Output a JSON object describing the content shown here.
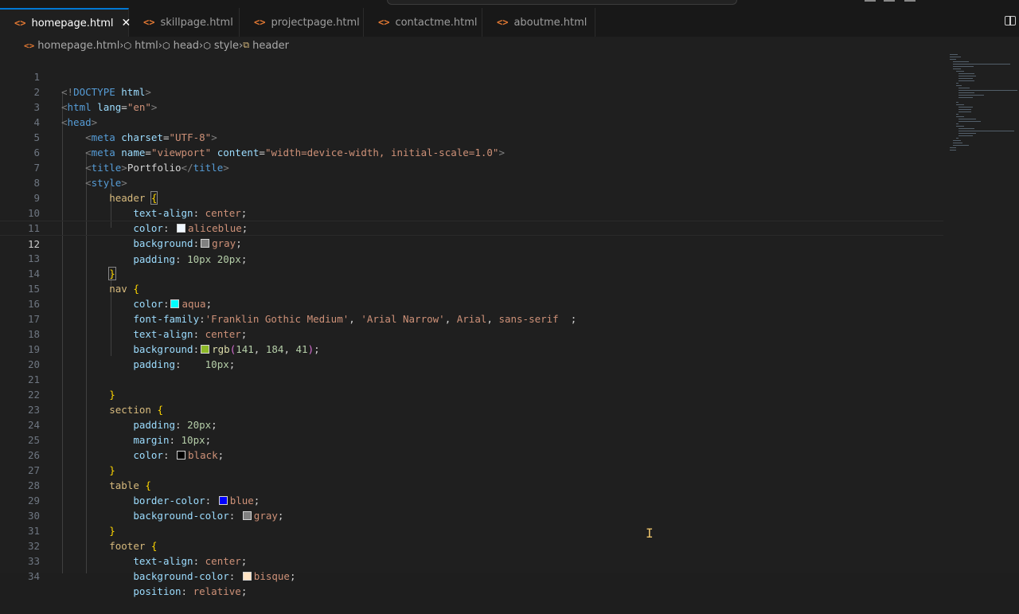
{
  "tabs": [
    {
      "label": "homepage.html",
      "active": true
    },
    {
      "label": "skillpage.html",
      "active": false
    },
    {
      "label": "projectpage.html",
      "active": false
    },
    {
      "label": "contactme.html",
      "active": false
    },
    {
      "label": "aboutme.html",
      "active": false
    }
  ],
  "breadcrumb": [
    "homepage.html",
    "html",
    "head",
    "style",
    "header"
  ],
  "icons": {
    "file": "html-file-icon",
    "close": "close-icon",
    "split": "split-editor-icon",
    "element": "element-icon",
    "selector": "selector-icon"
  },
  "colors": {
    "accent": "#0078d4",
    "aliceblue": "#f0f8ff",
    "gray": "#808080",
    "aqua": "#00ffff",
    "lime_rgb": "#8db829",
    "black": "#000000",
    "blue": "#0000ff",
    "bisque": "#ffe4c4"
  },
  "editor": {
    "current_line": 12,
    "lines": [
      {
        "n": "1"
      },
      {
        "n": "2"
      },
      {
        "n": "3"
      },
      {
        "n": "4"
      },
      {
        "n": "5"
      },
      {
        "n": "6"
      },
      {
        "n": "7"
      },
      {
        "n": "8"
      },
      {
        "n": "9"
      },
      {
        "n": "10"
      },
      {
        "n": "11"
      },
      {
        "n": "12"
      },
      {
        "n": "13"
      },
      {
        "n": "14"
      },
      {
        "n": "15"
      },
      {
        "n": "16"
      },
      {
        "n": "17"
      },
      {
        "n": "18"
      },
      {
        "n": "19"
      },
      {
        "n": "20"
      },
      {
        "n": "21"
      },
      {
        "n": "22"
      },
      {
        "n": "23"
      },
      {
        "n": "24"
      },
      {
        "n": "25"
      },
      {
        "n": "26"
      },
      {
        "n": "27"
      },
      {
        "n": "28"
      },
      {
        "n": "29"
      },
      {
        "n": "30"
      },
      {
        "n": "31"
      },
      {
        "n": "32"
      },
      {
        "n": "33"
      },
      {
        "n": "34"
      }
    ],
    "code": {
      "l1": {
        "open": "<!",
        "doctype": "DOCTYPE",
        "html": " html",
        "close": ">"
      },
      "l2": {
        "tag": "html",
        "attr": "lang",
        "val": "\"en\""
      },
      "l3": {
        "tag": "head"
      },
      "l4": {
        "tag": "meta",
        "attr": "charset",
        "val": "\"UTF-8\""
      },
      "l5": {
        "tag": "meta",
        "attr1": "name",
        "val1": "\"viewport\"",
        "attr2": "content",
        "val2": "\"width=device-width, initial-scale=1.0\""
      },
      "l6": {
        "tag": "title",
        "text": "Portfolio"
      },
      "l7": {
        "tag": "style"
      },
      "l8": {
        "sel": "header"
      },
      "l9": {
        "prop": "text-align",
        "val": "center"
      },
      "l10": {
        "prop": "color",
        "val": "aliceblue"
      },
      "l11": {
        "prop": "background",
        "val": "gray"
      },
      "l12": {
        "prop": "padding",
        "v1": "10px",
        "v2": "20px"
      },
      "l14": {
        "sel": "nav"
      },
      "l15": {
        "prop": "color",
        "val": "aqua"
      },
      "l16": {
        "prop": "font-family",
        "v1": "'Franklin Gothic Medium'",
        "v2": "'Arial Narrow'",
        "v3": "Arial",
        "v4": "sans-serif"
      },
      "l17": {
        "prop": "text-align",
        "val": "center"
      },
      "l18": {
        "prop": "background",
        "fn": "rgb",
        "a": "141",
        "b": "184",
        "c": "41"
      },
      "l19": {
        "prop": "padding",
        "val": "10px"
      },
      "l22": {
        "sel": "section"
      },
      "l23": {
        "prop": "padding",
        "val": "20px"
      },
      "l24": {
        "prop": "margin",
        "val": "10px"
      },
      "l25": {
        "prop": "color",
        "val": "black"
      },
      "l27": {
        "sel": "table"
      },
      "l28": {
        "prop": "border-color",
        "val": "blue"
      },
      "l29": {
        "prop": "background-color",
        "val": "gray"
      },
      "l31": {
        "sel": "footer"
      },
      "l32": {
        "prop": "text-align",
        "val": "center"
      },
      "l33": {
        "prop": "background-color",
        "val": "bisque"
      },
      "l34": {
        "prop": "position",
        "val": "relative"
      }
    }
  }
}
